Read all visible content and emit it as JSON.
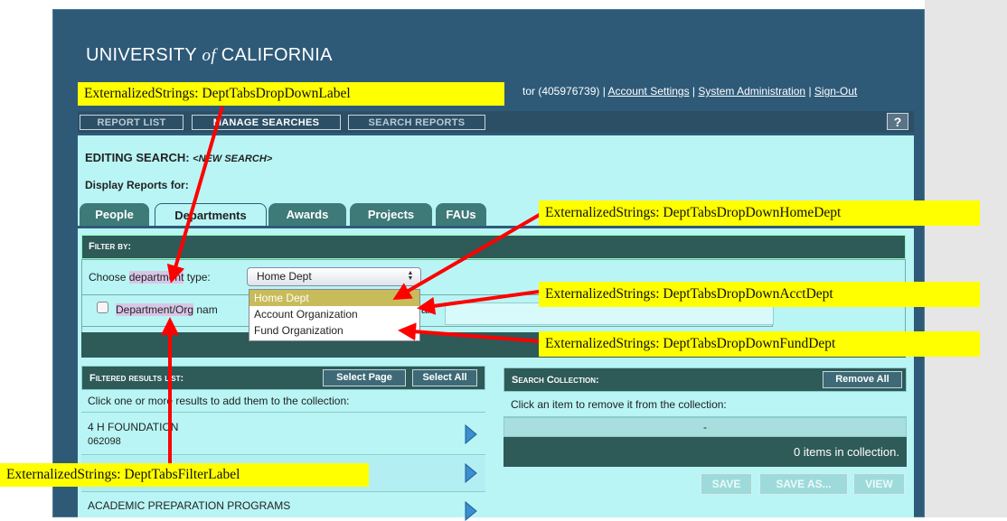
{
  "header": {
    "brand_pre": "UNIVERSITY ",
    "brand_of": "of",
    "brand_post": " CALIFORNIA",
    "user_text": "tor (405976739) | ",
    "account_settings": "Account Settings",
    "system_admin": "System Administration",
    "sign_out": "Sign-Out",
    "separator": " | "
  },
  "nav": {
    "report_list": "REPORT LIST",
    "manage_searches": "MANAGE SEARCHES",
    "search_reports": "SEARCH REPORTS",
    "help": "?"
  },
  "editing": {
    "label": "EDITING SEARCH: ",
    "name": "<NEW SEARCH>",
    "display_for": "Display Reports for:"
  },
  "tabs": [
    "People",
    "Departments",
    "Awards",
    "Projects",
    "FAUs"
  ],
  "active_tab": "Departments",
  "filter": {
    "header": "Filter by:",
    "choose_pre": "Choose ",
    "choose_word": "department",
    "choose_post": " type:",
    "select_value": "Home Dept",
    "options": [
      "Home Dept",
      "Account Organization",
      "Fund Organization"
    ],
    "checkbox_label_pre": "Department/Org",
    "checkbox_label_post": " nam",
    "checkbox_label_tail": "als"
  },
  "results": {
    "header": "Filtered results list:",
    "select_page": "Select Page",
    "select_all": "Select All",
    "instruction": "Click one or more results to add them to the collection:",
    "items": [
      {
        "name": "4 H FOUNDATION",
        "code": "062098"
      },
      {
        "name": "",
        "code": ""
      },
      {
        "name": "ACADEMIC PREPARATION PROGRAMS",
        "code": ""
      }
    ]
  },
  "collection": {
    "header": "Search Collection:",
    "remove_all": "Remove All",
    "instruction": "Click an item to remove it from the collection:",
    "dash": "-",
    "count_text": "0 items in collection.",
    "save": "SAVE",
    "save_as": "SAVE AS...",
    "view": "VIEW"
  },
  "annotations": {
    "label": "ExternalizedStrings: DeptTabsDropDownLabel",
    "home_dept": "ExternalizedStrings: DeptTabsDropDownHomeDept",
    "acct_dept": "ExternalizedStrings: DeptTabsDropDownAcctDept",
    "fund_dept": "ExternalizedStrings: DeptTabsDropDownFundDept",
    "filter_label": "ExternalizedStrings: DeptTabsFilterLabel"
  },
  "colors": {
    "frame": "#2e5a78",
    "content": "#b9f5f5",
    "panel_header": "#2e5a58",
    "annotation_bg": "#ffff00",
    "arrow": "#ff0000",
    "dropdown_selected": "#c8bc5a",
    "arrow_button": "#3b8ed0"
  },
  "icons": {
    "result_arrow": "triangle-right-icon",
    "checkbox": "checkbox-icon",
    "select_arrows": "updown-arrows-icon"
  }
}
